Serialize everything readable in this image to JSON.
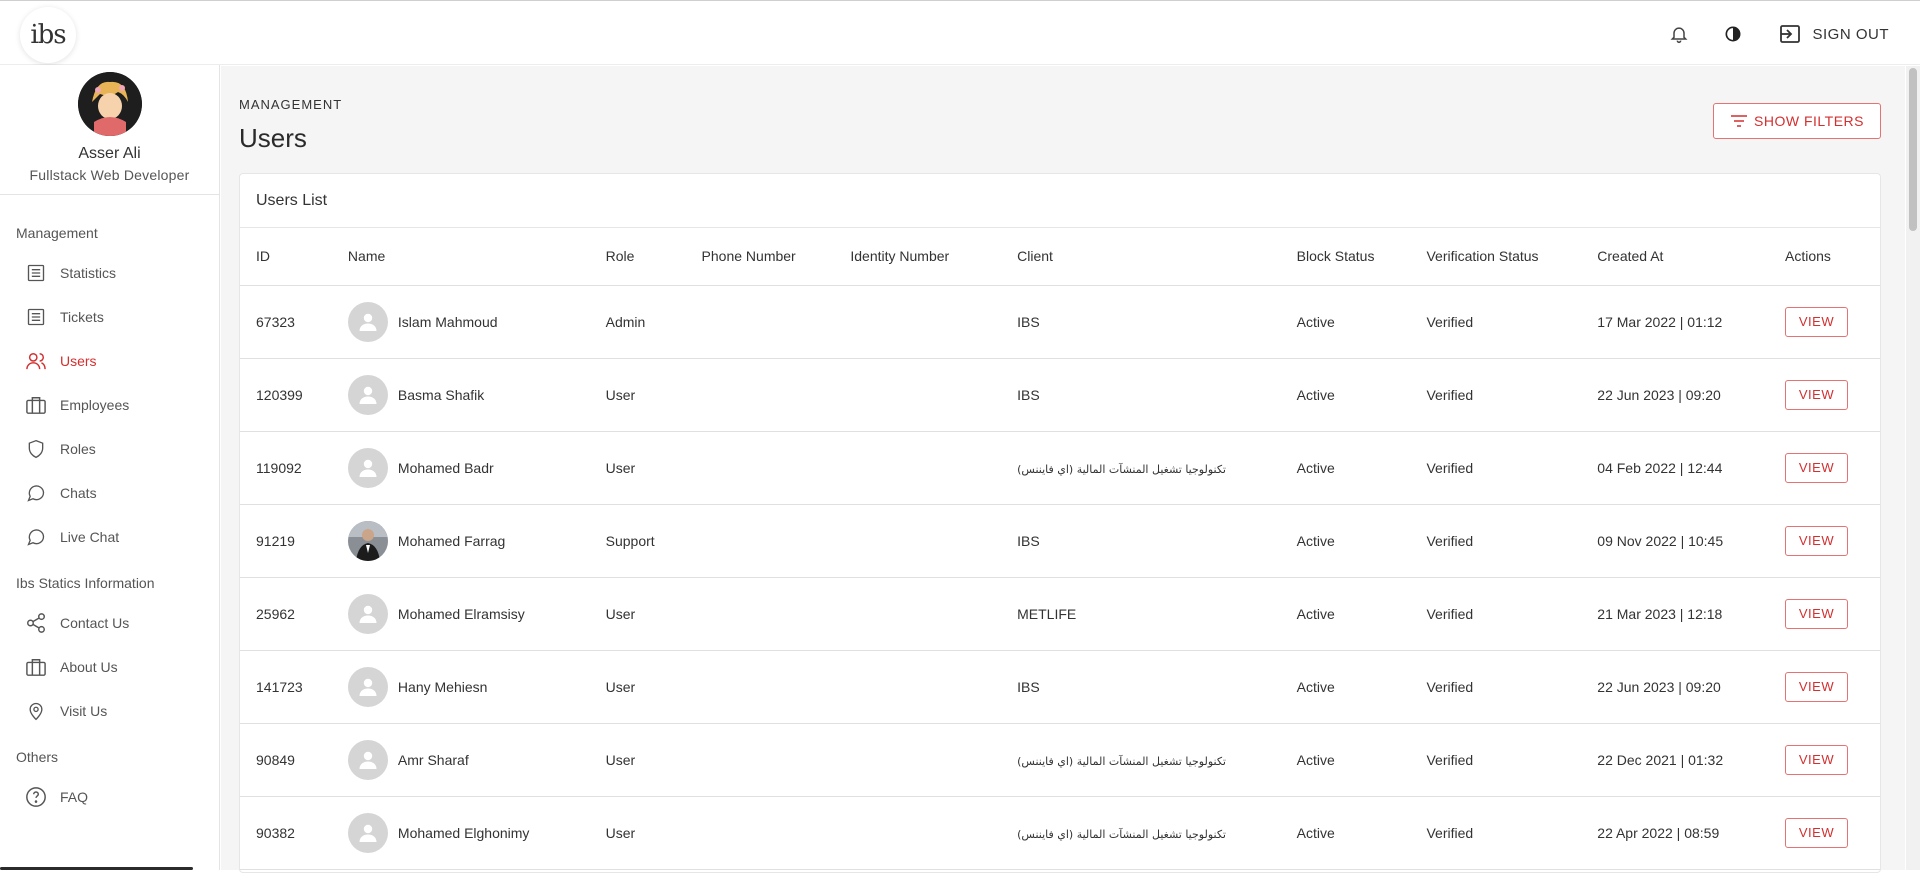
{
  "app": {
    "logo_text": "ibs",
    "signout_label": "SIGN OUT"
  },
  "profile": {
    "name": "Asser Ali",
    "title": "Fullstack Web Developer"
  },
  "sidebar": {
    "sections": [
      {
        "heading": "Management",
        "items": [
          {
            "label": "Statistics",
            "icon": "list-icon",
            "active": false
          },
          {
            "label": "Tickets",
            "icon": "list-icon",
            "active": false
          },
          {
            "label": "Users",
            "icon": "users-icon",
            "active": true
          },
          {
            "label": "Employees",
            "icon": "briefcase-icon",
            "active": false
          },
          {
            "label": "Roles",
            "icon": "shield-icon",
            "active": false
          },
          {
            "label": "Chats",
            "icon": "chat-bubble-icon",
            "active": false
          },
          {
            "label": "Live Chat",
            "icon": "chat-bubble-icon",
            "active": false
          }
        ]
      },
      {
        "heading": "Ibs Statics Information",
        "items": [
          {
            "label": "Contact Us",
            "icon": "share-icon",
            "active": false
          },
          {
            "label": "About Us",
            "icon": "briefcase-icon",
            "active": false
          },
          {
            "label": "Visit Us",
            "icon": "location-pin-icon",
            "active": false
          }
        ]
      },
      {
        "heading": "Others",
        "items": [
          {
            "label": "FAQ",
            "icon": "help-circle-icon",
            "active": false
          }
        ]
      }
    ]
  },
  "page": {
    "breadcrumb": "MANAGEMENT",
    "title": "Users",
    "filters_label": "SHOW FILTERS",
    "card_title": "Users List"
  },
  "table": {
    "columns": [
      "ID",
      "Name",
      "Role",
      "Phone Number",
      "Identity Number",
      "Client",
      "Block Status",
      "Verification Status",
      "Created At",
      "Actions"
    ],
    "action_label": "VIEW",
    "rows": [
      {
        "id": "67323",
        "name": "Islam Mahmoud",
        "role": "Admin",
        "phone": "",
        "identity": "",
        "client": "IBS",
        "client_rtl": false,
        "block": "Active",
        "verification": "Verified",
        "created": "17 Mar 2022 | 01:12",
        "photo": false
      },
      {
        "id": "120399",
        "name": "Basma Shafik",
        "role": "User",
        "phone": "",
        "identity": "",
        "client": "IBS",
        "client_rtl": false,
        "block": "Active",
        "verification": "Verified",
        "created": "22 Jun 2023 | 09:20",
        "photo": false
      },
      {
        "id": "119092",
        "name": "Mohamed Badr",
        "role": "User",
        "phone": "",
        "identity": "",
        "client": "تكنولوجيا تشغيل المنشآت المالية (اي فايننس)",
        "client_rtl": true,
        "block": "Active",
        "verification": "Verified",
        "created": "04 Feb 2022 | 12:44",
        "photo": false
      },
      {
        "id": "91219",
        "name": "Mohamed Farrag",
        "role": "Support",
        "phone": "",
        "identity": "",
        "client": "IBS",
        "client_rtl": false,
        "block": "Active",
        "verification": "Verified",
        "created": "09 Nov 2022 | 10:45",
        "photo": true
      },
      {
        "id": "25962",
        "name": "Mohamed Elramsisy",
        "role": "User",
        "phone": "",
        "identity": "",
        "client": "METLIFE",
        "client_rtl": false,
        "block": "Active",
        "verification": "Verified",
        "created": "21 Mar 2023 | 12:18",
        "photo": false
      },
      {
        "id": "141723",
        "name": "Hany Mehiesn",
        "role": "User",
        "phone": "",
        "identity": "",
        "client": "IBS",
        "client_rtl": false,
        "block": "Active",
        "verification": "Verified",
        "created": "22 Jun 2023 | 09:20",
        "photo": false
      },
      {
        "id": "90849",
        "name": "Amr Sharaf",
        "role": "User",
        "phone": "",
        "identity": "",
        "client": "تكنولوجيا تشغيل المنشآت المالية (اي فايننس)",
        "client_rtl": true,
        "block": "Active",
        "verification": "Verified",
        "created": "22 Dec 2021 | 01:32",
        "photo": false
      },
      {
        "id": "90382",
        "name": "Mohamed Elghonimy",
        "role": "User",
        "phone": "",
        "identity": "",
        "client": "تكنولوجيا تشغيل المنشآت المالية (اي فايننس)",
        "client_rtl": true,
        "block": "Active",
        "verification": "Verified",
        "created": "22 Apr 2022 | 08:59",
        "photo": false
      }
    ]
  },
  "colors": {
    "accent": "#d32f2f",
    "background": "#f5f5f5"
  }
}
